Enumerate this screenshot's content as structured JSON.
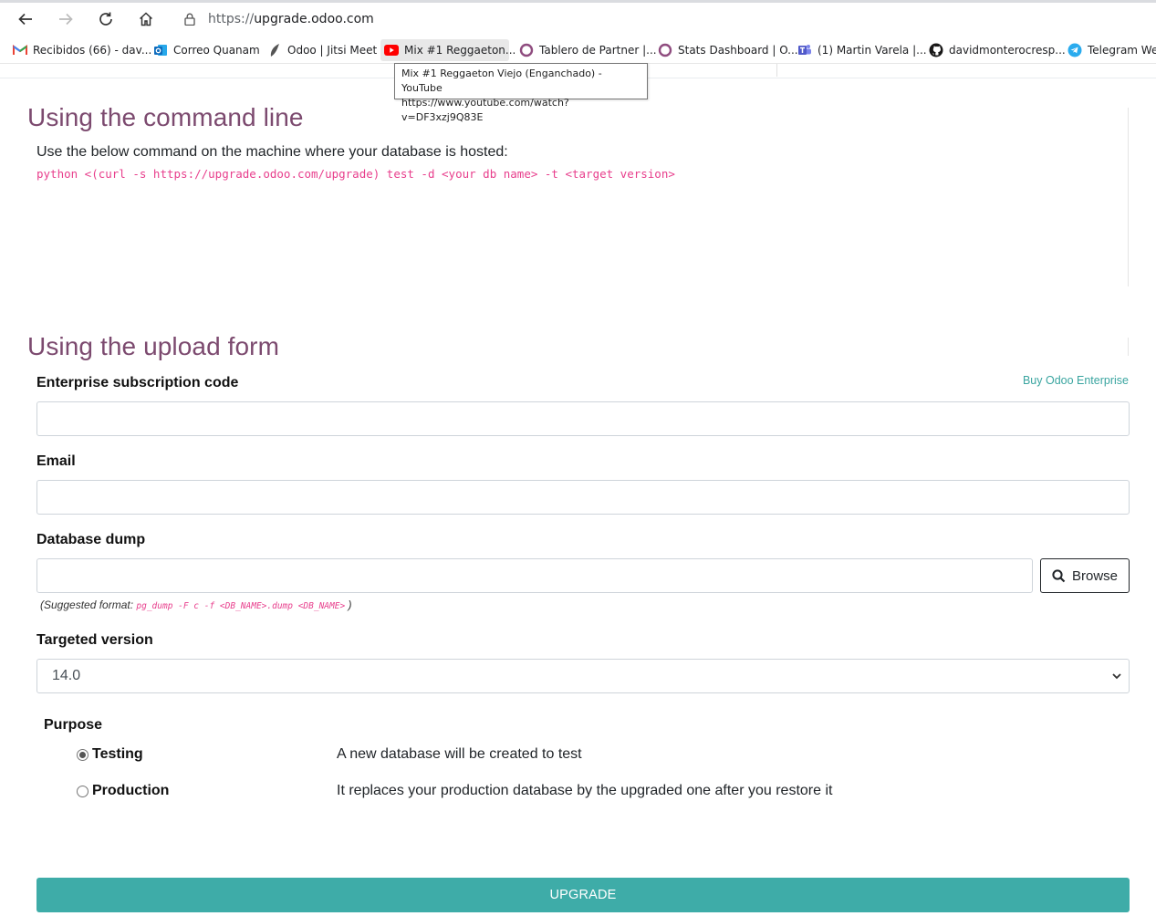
{
  "browser": {
    "url_scheme": "https://",
    "url_host": "upgrade.odoo.com",
    "bookmarks": [
      {
        "label": "Recibidos (66) - dav...",
        "icon": "gmail-icon"
      },
      {
        "label": "Correo Quanam",
        "icon": "outlook-icon"
      },
      {
        "label": "Odoo | Jitsi Meet",
        "icon": "jitsi-icon"
      },
      {
        "label": "Mix #1 Reggaeton...",
        "icon": "youtube-icon"
      },
      {
        "label": "Tablero de Partner |...",
        "icon": "odoo-circle-icon"
      },
      {
        "label": "Stats Dashboard | O...",
        "icon": "odoo-circle-icon"
      },
      {
        "label": "(1) Martin Varela |...",
        "icon": "teams-icon"
      },
      {
        "label": "davidmonterocresp...",
        "icon": "github-icon"
      },
      {
        "label": "Telegram Web",
        "icon": "telegram-icon"
      }
    ],
    "tooltip_title": "Mix #1 Reggaeton Viejo (Enganchado) - YouTube",
    "tooltip_url": "https://www.youtube.com/watch?v=DF3xzj9Q83E"
  },
  "cmdline": {
    "title": "Using the command line",
    "intro": "Use the below command on the machine where your database is hosted:",
    "command": "python <(curl -s https://upgrade.odoo.com/upgrade) test -d <your db name> -t <target version>"
  },
  "form": {
    "title": "Using the upload form",
    "enterprise_label": "Enterprise subscription code",
    "buy_link": "Buy Odoo Enterprise",
    "enterprise_value": "",
    "email_label": "Email",
    "email_value": "",
    "dump_label": "Database dump",
    "dump_value": "",
    "browse_label": "Browse",
    "hint_prefix": "(Suggested format: ",
    "hint_code": "pg_dump -F c -f <DB_NAME>.dump <DB_NAME>",
    "hint_suffix": " )",
    "version_label": "Targeted version",
    "version_value": "14.0",
    "purpose_label": "Purpose",
    "purposes": [
      {
        "label": "Testing",
        "description": "A new database will be created to test",
        "checked": true
      },
      {
        "label": "Production",
        "description": "It replaces your production database by the upgraded one after you restore it",
        "checked": false
      }
    ],
    "submit_label": "UPGRADE"
  },
  "colors": {
    "heading": "#7c4a6f",
    "code": "#e83e8c",
    "accent": "#3eaca8"
  }
}
